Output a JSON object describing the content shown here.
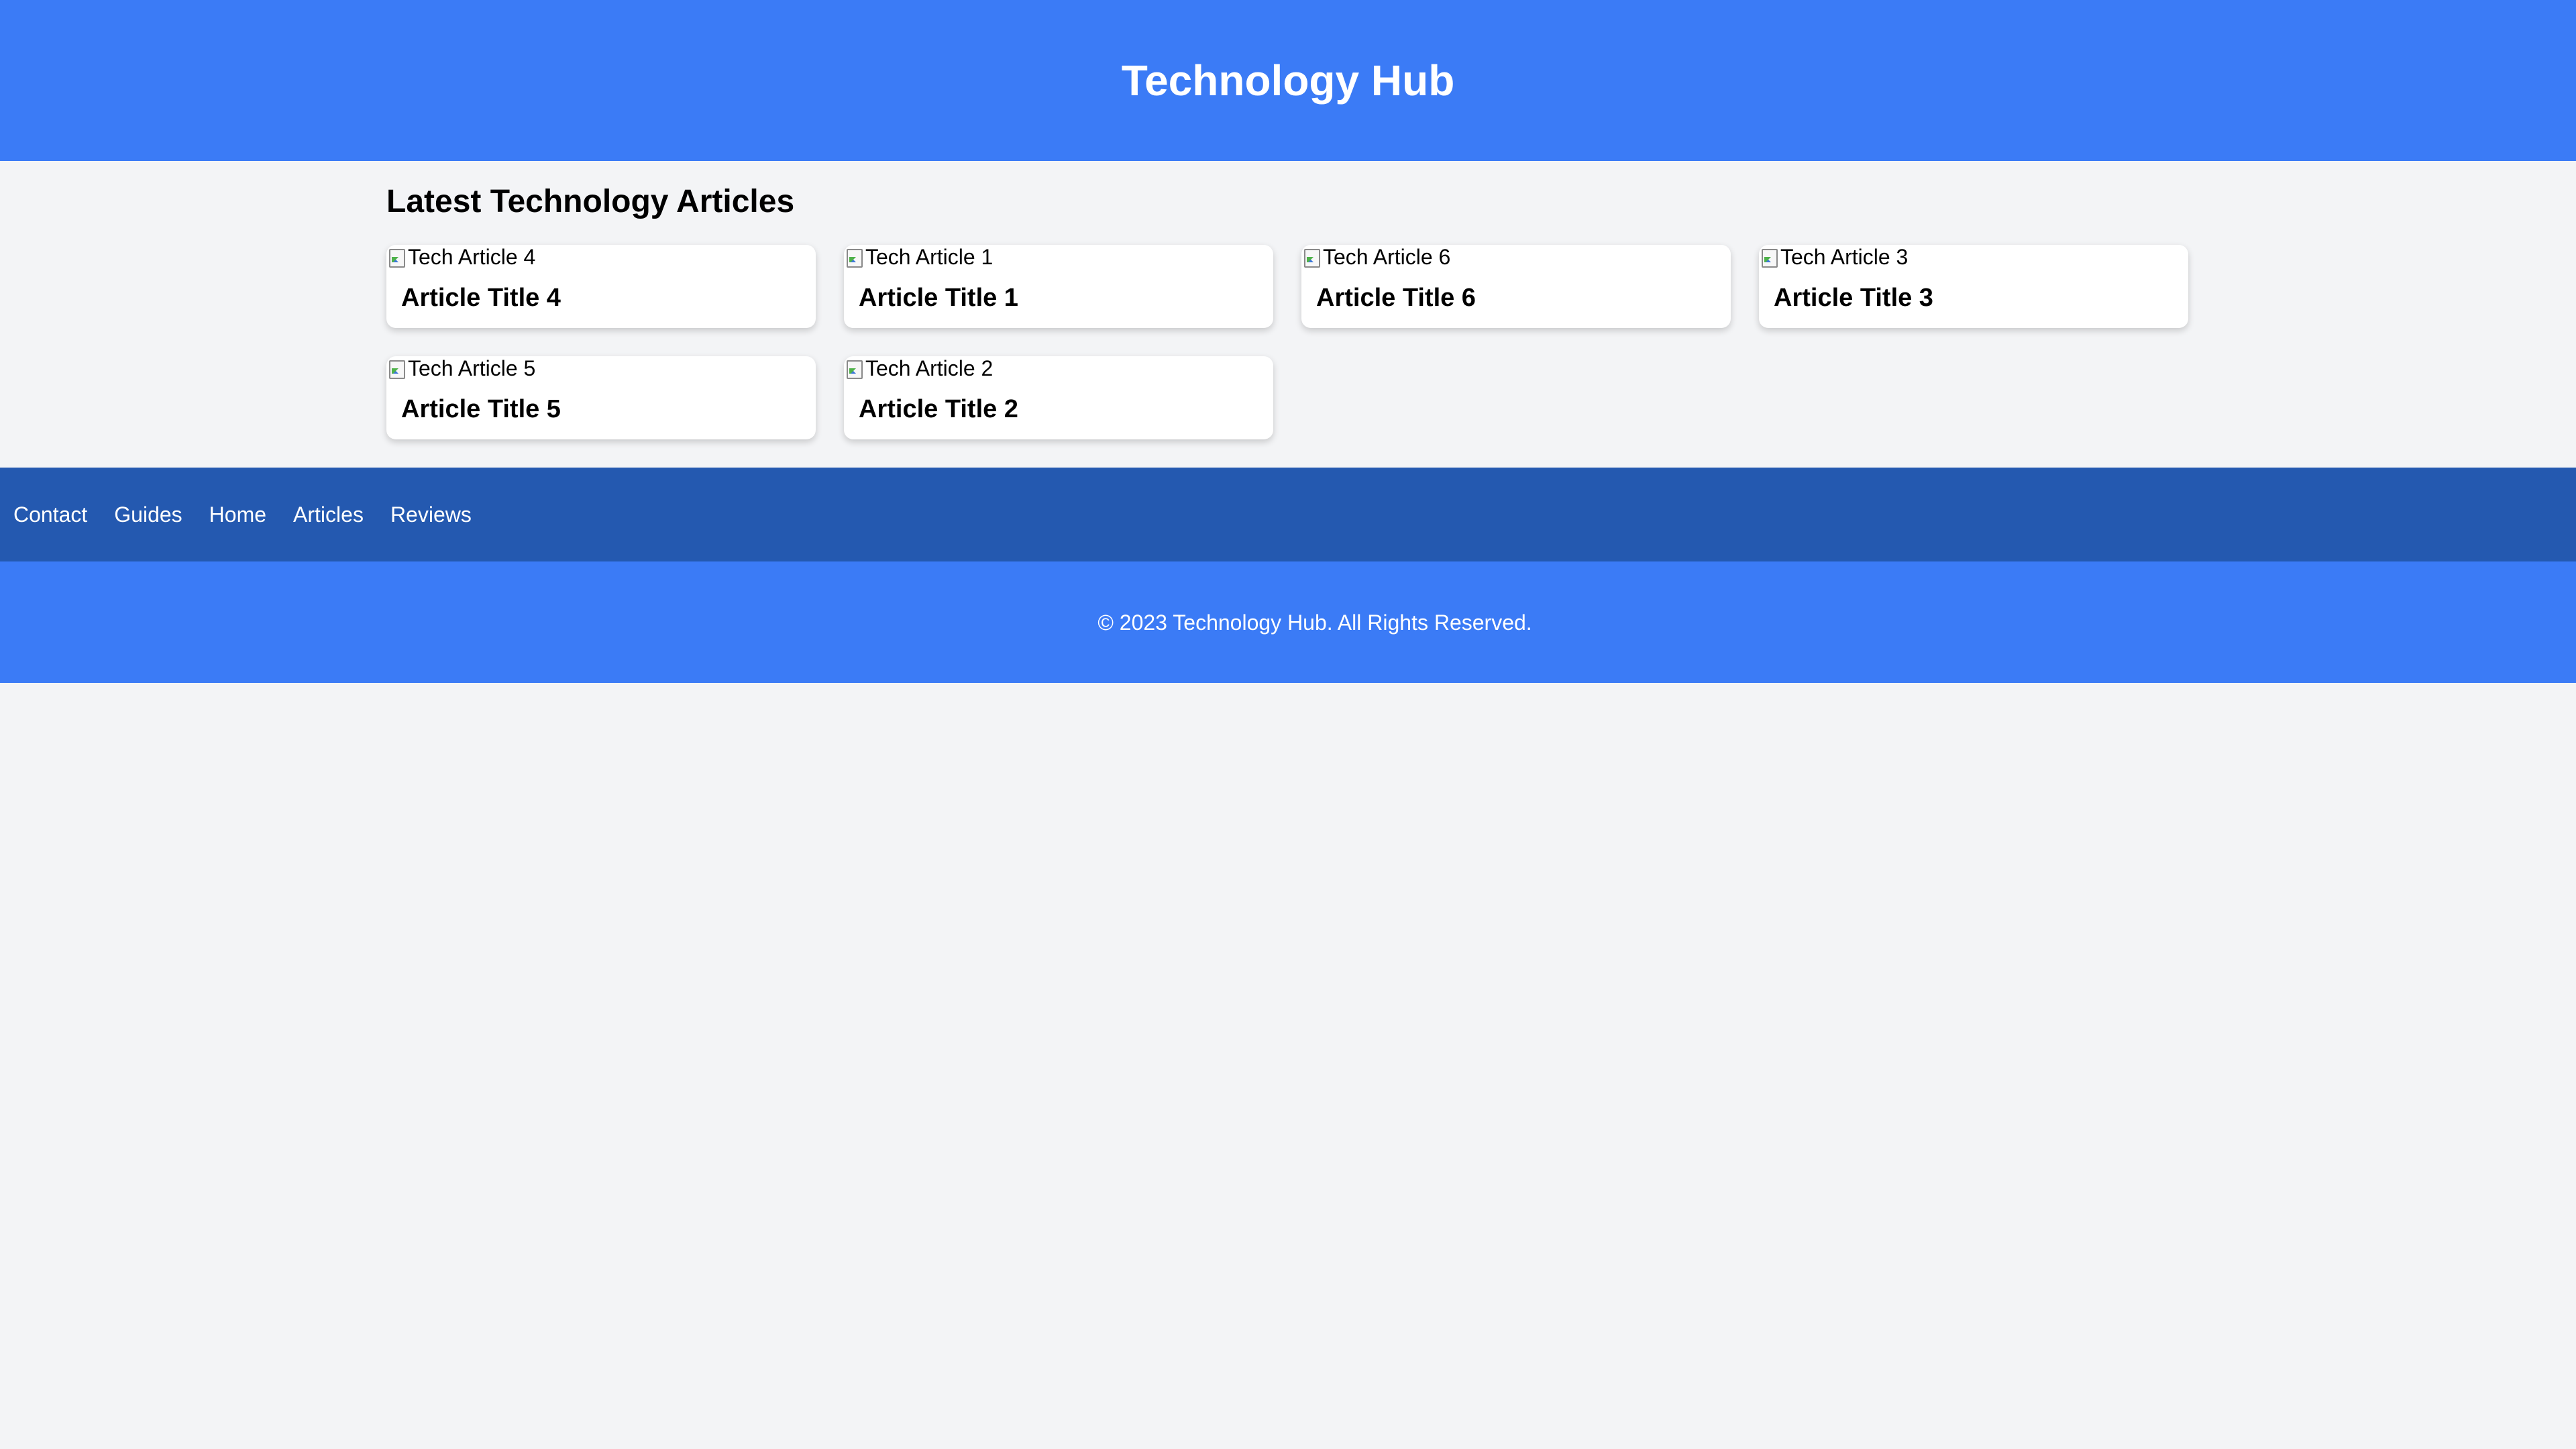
{
  "header": {
    "title": "Technology Hub"
  },
  "main": {
    "section_heading": "Latest Technology Articles",
    "articles": [
      {
        "image_alt": "Tech Article 4",
        "title": "Article Title 4"
      },
      {
        "image_alt": "Tech Article 1",
        "title": "Article Title 1"
      },
      {
        "image_alt": "Tech Article 6",
        "title": "Article Title 6"
      },
      {
        "image_alt": "Tech Article 3",
        "title": "Article Title 3"
      },
      {
        "image_alt": "Tech Article 5",
        "title": "Article Title 5"
      },
      {
        "image_alt": "Tech Article 2",
        "title": "Article Title 2"
      }
    ]
  },
  "nav": {
    "items": [
      {
        "label": "Contact"
      },
      {
        "label": "Guides"
      },
      {
        "label": "Home"
      },
      {
        "label": "Articles"
      },
      {
        "label": "Reviews"
      }
    ]
  },
  "footer": {
    "text": "© 2023 Technology Hub. All Rights Reserved."
  },
  "colors": {
    "header_bg": "#3b7bf6",
    "nav_bg": "#2459b0",
    "page_bg": "#f3f4f6",
    "card_bg": "#ffffff"
  }
}
